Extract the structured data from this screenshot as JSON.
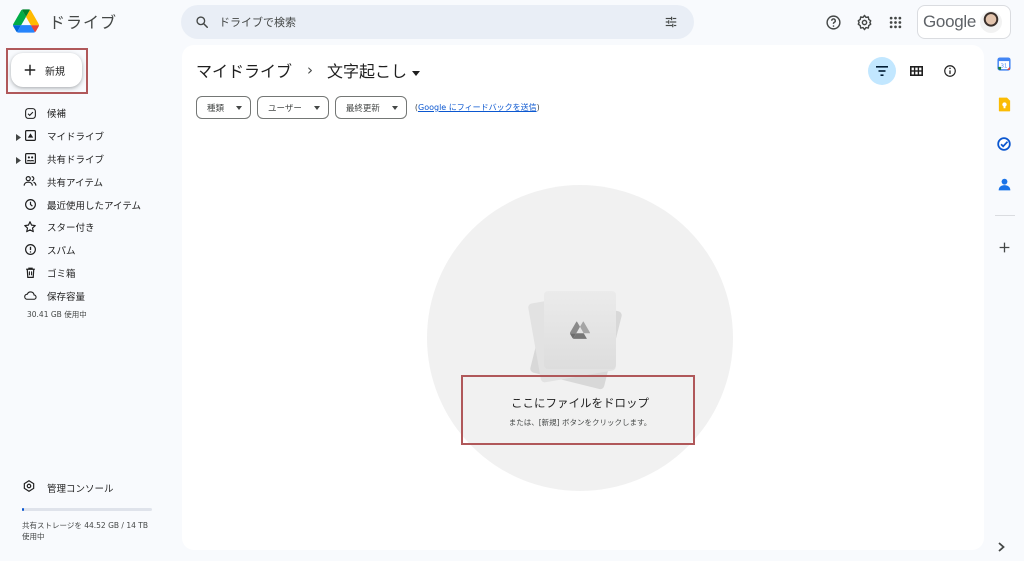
{
  "app": {
    "title": "ドライブ"
  },
  "search": {
    "placeholder": "ドライブで検索"
  },
  "account": {
    "brand": "Google"
  },
  "new_button": {
    "label": "新規"
  },
  "sidebar": {
    "items": [
      {
        "label": "候補",
        "icon": "suggested-icon",
        "expandable": false
      },
      {
        "label": "マイドライブ",
        "icon": "my-drive-icon",
        "expandable": true
      },
      {
        "label": "共有ドライブ",
        "icon": "shared-drives-icon",
        "expandable": true
      },
      {
        "label": "共有アイテム",
        "icon": "shared-people-icon",
        "expandable": false
      },
      {
        "label": "最近使用したアイテム",
        "icon": "clock-icon",
        "expandable": false
      },
      {
        "label": "スター付き",
        "icon": "star-icon",
        "expandable": false
      },
      {
        "label": "スパム",
        "icon": "spam-icon",
        "expandable": false
      },
      {
        "label": "ゴミ箱",
        "icon": "trash-icon",
        "expandable": false
      },
      {
        "label": "保存容量",
        "icon": "cloud-icon",
        "expandable": false
      }
    ],
    "storage_used": "30.41 GB 使用中",
    "admin_console": "管理コンソール",
    "shared_storage": "共有ストレージを 44.52 GB / 14 TB 使用中",
    "shared_storage_fraction": 0.003
  },
  "breadcrumb": {
    "root": "マイドライブ",
    "separator": "›",
    "current": "文字起こし"
  },
  "filters": {
    "chips": [
      "種類",
      "ユーザー",
      "最終更新"
    ],
    "feedback_prefix": "(",
    "feedback_link": "Google にフィードバックを送信",
    "feedback_suffix": ")"
  },
  "empty_state": {
    "title": "ここにファイルをドロップ",
    "subtitle": "または、[新規] ボタンをクリックします。"
  },
  "colors": {
    "accent": "#0b57d0",
    "active_filter_bg": "#c2e7ff",
    "highlight_border": "#b0585a",
    "page_bg": "#f8fafd"
  }
}
